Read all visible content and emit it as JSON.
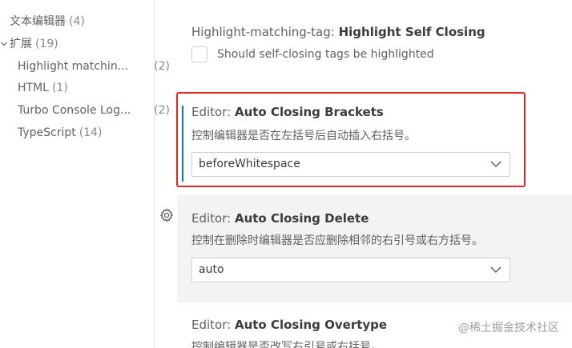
{
  "sidebar": {
    "items": [
      {
        "label": "文本编辑器",
        "count": "(4)"
      },
      {
        "label": "扩展",
        "count": "(19)"
      },
      {
        "label": "Highlight matchin...",
        "count": "(2)"
      },
      {
        "label": "HTML",
        "count": "(1)"
      },
      {
        "label": "Turbo Console Log...",
        "count": "(2)"
      },
      {
        "label": "TypeScript",
        "count": "(14)"
      }
    ]
  },
  "settings": {
    "highlight_self_closing": {
      "category": "Highlight-matching-tag:",
      "name": "Highlight Self Closing",
      "checkbox_label": "Should self-closing tags be highlighted"
    },
    "auto_closing_brackets": {
      "category": "Editor:",
      "name": "Auto Closing Brackets",
      "description": "控制编辑器是否在左括号后自动插入右括号。",
      "value": "beforeWhitespace"
    },
    "auto_closing_delete": {
      "category": "Editor:",
      "name": "Auto Closing Delete",
      "description": "控制在删除时编辑器是否应删除相邻的右引号或右方括号。",
      "value": "auto"
    },
    "auto_closing_overtype": {
      "category": "Editor:",
      "name": "Auto Closing Overtype",
      "description": "控制编辑器是否改写右引号或右括号。"
    }
  },
  "icons": {
    "gear": "gear-icon",
    "chevron": "chevron-down-icon"
  },
  "colors": {
    "highlight_border": "#e0262a",
    "focus_bar": "#0078d4",
    "hover_background": "#f3f3f3"
  },
  "watermark": "@稀土掘金技术社区"
}
